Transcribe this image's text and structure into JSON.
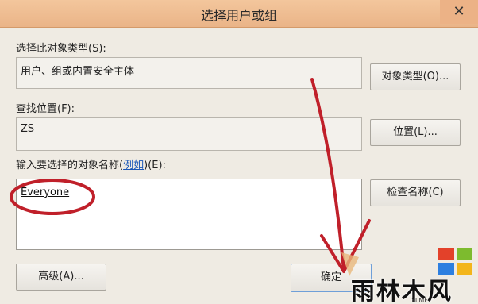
{
  "dialog": {
    "title": "选择用户或组",
    "close_glyph": "✕"
  },
  "object_type": {
    "label": "选择此对象类型(S):",
    "value": "用户、组或内置安全主体",
    "button_label": "对象类型(O)..."
  },
  "location": {
    "label": "查找位置(F):",
    "value": "ZS",
    "button_label": "位置(L)..."
  },
  "names": {
    "label_prefix": "输入要选择的对象名称(",
    "example_link": "例如",
    "label_suffix": ")(E):",
    "value": "Everyone",
    "check_button_label": "检查名称(C)"
  },
  "footer": {
    "advanced_button_label": "高级(A)...",
    "ok_button_label": "确定"
  },
  "watermark": {
    "text": "雨林木风",
    "subtext": "YLMF"
  },
  "annotation_colors": {
    "arrow": "#c0202a",
    "circle": "#c0202a"
  }
}
